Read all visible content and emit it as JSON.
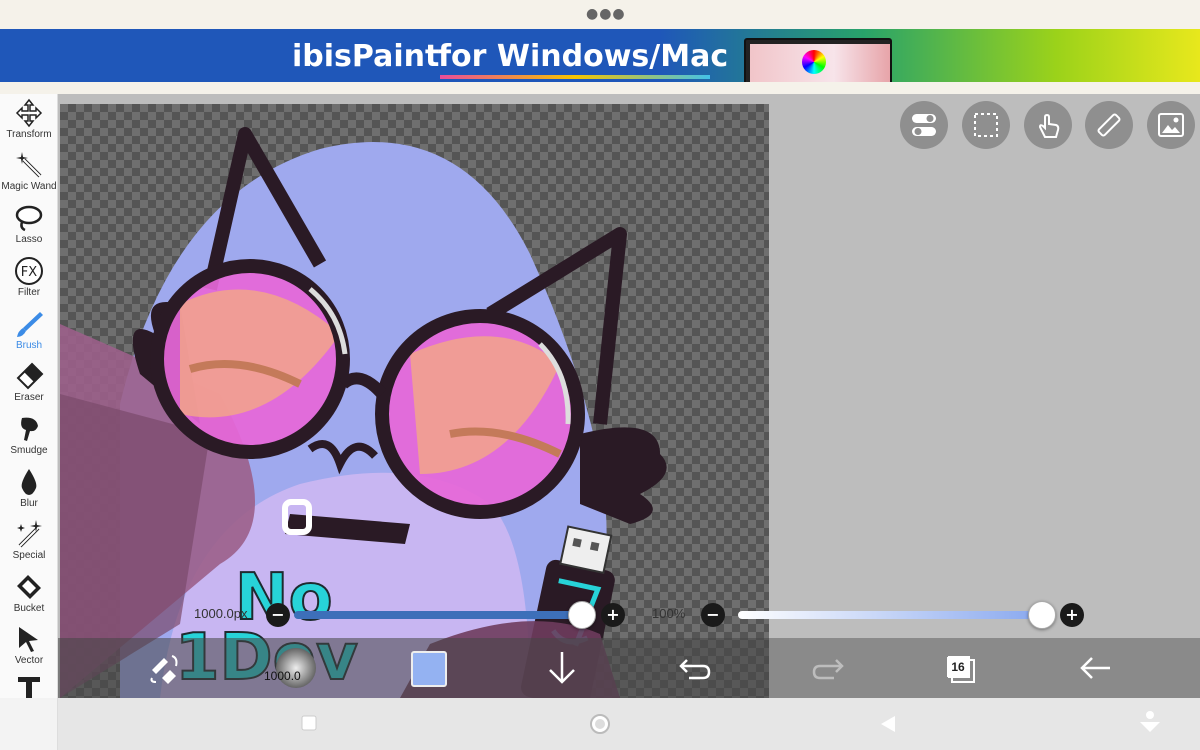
{
  "banner": {
    "brand": "ibisPaint",
    "tagline": "for Windows/Mac"
  },
  "tools": [
    {
      "label": "Transform",
      "icon": "move-arrows-icon",
      "active": false
    },
    {
      "label": "Magic Wand",
      "icon": "magic-wand-icon",
      "active": false
    },
    {
      "label": "Lasso",
      "icon": "lasso-icon",
      "active": false
    },
    {
      "label": "Filter",
      "icon": "fx-filter-icon",
      "active": false
    },
    {
      "label": "Brush",
      "icon": "brush-icon",
      "active": true
    },
    {
      "label": "Eraser",
      "icon": "eraser-icon",
      "active": false
    },
    {
      "label": "Smudge",
      "icon": "smudge-finger-icon",
      "active": false
    },
    {
      "label": "Blur",
      "icon": "blur-drop-icon",
      "active": false
    },
    {
      "label": "Special",
      "icon": "special-sparkle-icon",
      "active": false
    },
    {
      "label": "Bucket",
      "icon": "bucket-icon",
      "active": false
    },
    {
      "label": "Vector",
      "icon": "vector-cursor-icon",
      "active": false
    },
    {
      "label": "",
      "icon": "text-tool-icon",
      "active": false
    }
  ],
  "top_buttons": [
    "toggle-icon",
    "selection-icon",
    "hand-gesture-icon",
    "ruler-icon",
    "image-icon"
  ],
  "brush_size": {
    "label": "1000.0px",
    "value_fraction": 1.0
  },
  "opacity": {
    "label": "100%",
    "value_fraction": 1.0
  },
  "bottom_bar": {
    "brush_size_value": "1000.0",
    "current_color": "#94b2f2",
    "layer_count": "16"
  },
  "colors": {
    "accent": "#3b8be6",
    "brush_track": "#3d6fb9"
  }
}
